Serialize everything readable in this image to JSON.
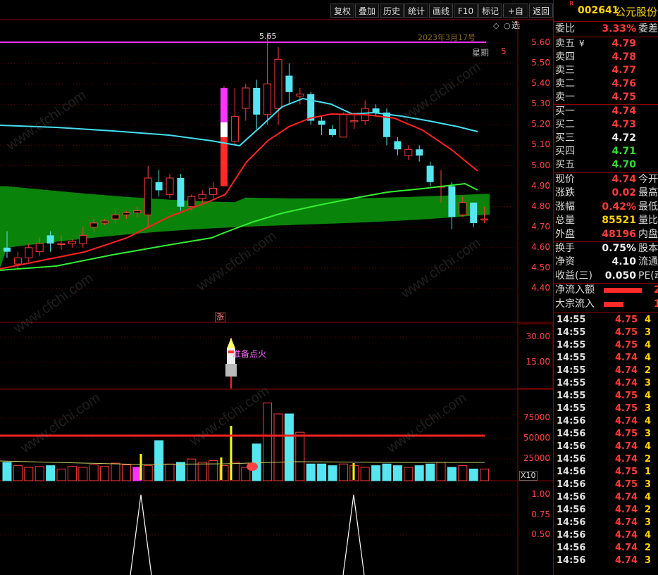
{
  "toolbar": {
    "buttons": [
      "复权",
      "叠加",
      "历史",
      "统计",
      "画线",
      "F10",
      "标记",
      "+自选",
      "返回"
    ]
  },
  "stock": {
    "badge": "R",
    "code": "002641",
    "name": "公元股份"
  },
  "quote": {
    "weibi_label": "委比",
    "weibi": "3.33%",
    "weicha_label": "委差",
    "asks": [
      {
        "label": "卖五",
        "val": "4.79",
        "mark": "¥"
      },
      {
        "label": "卖四",
        "val": "4.78"
      },
      {
        "label": "卖三",
        "val": "4.77"
      },
      {
        "label": "卖二",
        "val": "4.76"
      },
      {
        "label": "卖一",
        "val": "4.75"
      }
    ],
    "bids": [
      {
        "label": "买一",
        "val": "4.74",
        "color": "red"
      },
      {
        "label": "买二",
        "val": "4.73",
        "color": "red"
      },
      {
        "label": "买三",
        "val": "4.72",
        "color": "white"
      },
      {
        "label": "买四",
        "val": "4.71",
        "color": "green"
      },
      {
        "label": "买五",
        "val": "4.70",
        "color": "green"
      }
    ],
    "stats": [
      {
        "label": "现价",
        "val": "4.74",
        "color": "red",
        "label2": "今开"
      },
      {
        "label": "涨跌",
        "val": "0.02",
        "color": "red",
        "label2": "最高"
      },
      {
        "label": "涨幅",
        "val": "0.42%",
        "color": "red",
        "label2": "最低"
      },
      {
        "label": "总量",
        "val": "85521",
        "color": "yellow",
        "label2": "量比"
      },
      {
        "label": "外盘",
        "val": "48196",
        "color": "red",
        "label2": "内盘"
      }
    ],
    "stats2": [
      {
        "label": "换手",
        "val": "0.75%",
        "color": "white",
        "label2": "股本"
      },
      {
        "label": "净资",
        "val": "4.10",
        "color": "white",
        "label2": "流通"
      },
      {
        "label": "收益(三)",
        "val": "0.050",
        "color": "white",
        "label2": "PE(动)"
      }
    ],
    "flows": [
      {
        "label": "净流入额",
        "val": "2"
      },
      {
        "label": "大宗流入",
        "val": "1"
      }
    ]
  },
  "ticks": [
    {
      "t": "14:55",
      "p": "4.75",
      "q": "4"
    },
    {
      "t": "14:55",
      "p": "4.75",
      "q": "3"
    },
    {
      "t": "14:55",
      "p": "4.75",
      "q": "4"
    },
    {
      "t": "14:55",
      "p": "4.74",
      "q": "4"
    },
    {
      "t": "14:55",
      "p": "4.74",
      "q": "2"
    },
    {
      "t": "14:55",
      "p": "4.74",
      "q": "3"
    },
    {
      "t": "14:55",
      "p": "4.75",
      "q": "4"
    },
    {
      "t": "14:55",
      "p": "4.75",
      "q": "3"
    },
    {
      "t": "14:56",
      "p": "4.74",
      "q": "4"
    },
    {
      "t": "14:56",
      "p": "4.75",
      "q": "3"
    },
    {
      "t": "14:56",
      "p": "4.74",
      "q": "4"
    },
    {
      "t": "14:56",
      "p": "4.74",
      "q": "2"
    },
    {
      "t": "14:56",
      "p": "4.75",
      "q": "1"
    },
    {
      "t": "14:56",
      "p": "4.75",
      "q": "3"
    },
    {
      "t": "14:56",
      "p": "4.74",
      "q": "4"
    },
    {
      "t": "14:56",
      "p": "4.74",
      "q": "2"
    },
    {
      "t": "14:56",
      "p": "4.74",
      "q": "3"
    },
    {
      "t": "14:56",
      "p": "4.74",
      "q": "4"
    },
    {
      "t": "14:56",
      "p": "4.74",
      "q": "2"
    },
    {
      "t": "14:56",
      "p": "4.74",
      "q": "3"
    }
  ],
  "chart": {
    "peak_label": "5.65",
    "date_label": "2023年3月17号",
    "weekday_label": "星期",
    "weekday_val": "5",
    "zhang_label": "涨",
    "rocket_label": "准备点火",
    "x10_label": "X10",
    "price_axis": [
      "5.60",
      "5.50",
      "5.40",
      "5.30",
      "5.20",
      "5.10",
      "5.00",
      "4.90",
      "4.80",
      "4.70",
      "4.60",
      "4.50",
      "4.40"
    ],
    "ind_axis": [
      "30.00",
      "15.00"
    ],
    "vol_axis": [
      "75000",
      "50000",
      "25000"
    ],
    "sig_axis": [
      "1.00",
      "0.75",
      "0.50"
    ],
    "watermark": "www.cfchi.com"
  },
  "chart_data": {
    "type": "candlestick",
    "price_range": [
      4.35,
      5.68
    ],
    "candles": [
      [
        4.6,
        4.58,
        4.68,
        4.55
      ],
      [
        4.52,
        4.55,
        4.58,
        4.5
      ],
      [
        4.55,
        4.6,
        4.62,
        4.53
      ],
      [
        4.58,
        4.62,
        4.65,
        4.56
      ],
      [
        4.66,
        4.62,
        4.68,
        4.58
      ],
      [
        4.62,
        4.62,
        4.66,
        4.59
      ],
      [
        4.62,
        4.63,
        4.64,
        4.6
      ],
      [
        4.62,
        4.66,
        4.7,
        4.6
      ],
      [
        4.7,
        4.72,
        4.74,
        4.68
      ],
      [
        4.72,
        4.73,
        4.74,
        4.71
      ],
      [
        4.74,
        4.76,
        4.78,
        4.72
      ],
      [
        4.76,
        4.77,
        4.78,
        4.74
      ],
      [
        4.77,
        4.78,
        4.8,
        4.75
      ],
      [
        4.76,
        4.94,
        5.0,
        4.7
      ],
      [
        4.92,
        4.88,
        4.98,
        4.85
      ],
      [
        4.86,
        4.94,
        4.96,
        4.84
      ],
      [
        4.94,
        4.8,
        4.96,
        4.78
      ],
      [
        4.8,
        4.85,
        4.86,
        4.78
      ],
      [
        4.84,
        4.86,
        4.88,
        4.82
      ],
      [
        4.86,
        4.89,
        4.92,
        4.84
      ],
      [
        4.9,
        5.38,
        5.39,
        4.9
      ],
      [
        5.12,
        5.24,
        5.38,
        5.1
      ],
      [
        5.28,
        5.38,
        5.4,
        5.22
      ],
      [
        5.38,
        5.25,
        5.42,
        5.18
      ],
      [
        5.25,
        5.4,
        5.65,
        5.2
      ],
      [
        5.28,
        5.52,
        5.58,
        5.2
      ],
      [
        5.44,
        5.36,
        5.5,
        5.3
      ],
      [
        5.34,
        5.35,
        5.38,
        5.3
      ],
      [
        5.35,
        5.22,
        5.36,
        5.2
      ],
      [
        5.22,
        5.2,
        5.24,
        5.15
      ],
      [
        5.18,
        5.15,
        5.2,
        5.14
      ],
      [
        5.14,
        5.25,
        5.26,
        5.14
      ],
      [
        5.22,
        5.22,
        5.26,
        5.18
      ],
      [
        5.22,
        5.28,
        5.32,
        5.2
      ],
      [
        5.28,
        5.26,
        5.3,
        5.24
      ],
      [
        5.26,
        5.14,
        5.28,
        5.1
      ],
      [
        5.12,
        5.08,
        5.14,
        5.05
      ],
      [
        5.05,
        5.08,
        5.1,
        5.03
      ],
      [
        5.08,
        5.05,
        5.1,
        5.02
      ],
      [
        5.0,
        4.92,
        5.02,
        4.9
      ],
      [
        4.9,
        4.9,
        4.98,
        4.82
      ],
      [
        4.9,
        4.75,
        4.92,
        4.69
      ],
      [
        4.76,
        4.82,
        4.85,
        4.75
      ],
      [
        4.82,
        4.72,
        4.82,
        4.7
      ],
      [
        4.74,
        4.74,
        4.8,
        4.72
      ]
    ],
    "volumes": [
      22,
      18,
      16,
      17,
      18,
      14,
      17,
      16,
      19,
      17,
      21,
      19,
      16,
      18,
      48,
      20,
      22,
      26,
      22,
      24,
      18,
      22,
      16,
      44,
      93,
      80,
      80,
      58,
      20,
      20,
      18,
      20,
      18,
      16,
      18,
      20,
      18,
      16,
      18,
      20,
      22,
      16,
      18,
      14,
      14
    ],
    "vol_range": [
      0,
      100000
    ],
    "vol_ma": 52000
  }
}
